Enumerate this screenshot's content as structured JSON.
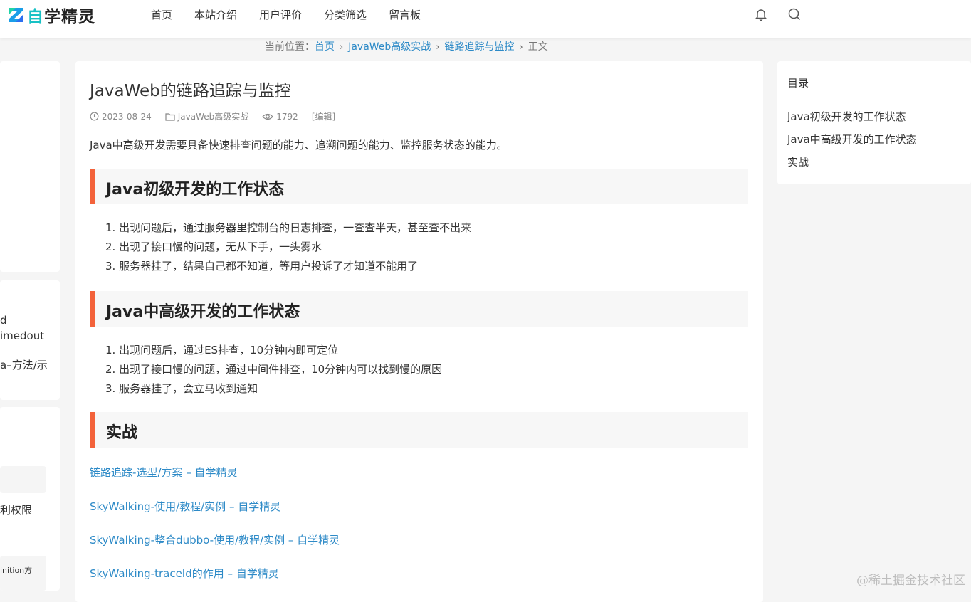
{
  "header": {
    "logo_mark": "Z",
    "logo_zi": "自",
    "logo_rest": "学精灵",
    "nav": [
      "首页",
      "本站介绍",
      "用户评价",
      "分类筛选",
      "留言板"
    ]
  },
  "breadcrumb": {
    "prefix": "当前位置：",
    "items": [
      "首页",
      "JavaWeb高级实战",
      "链路追踪与监控"
    ],
    "current": "正文",
    "sep": "›"
  },
  "left_sidebar": {
    "texts": [
      "d",
      "imedout",
      "a–方法/示",
      "利权限",
      "inition方"
    ]
  },
  "article": {
    "title": "JavaWeb的链路追踪与监控",
    "date": "2023-08-24",
    "category": "JavaWeb高级实战",
    "views": "1792",
    "edit": "[编辑]",
    "intro": "Java中高级开发需要具备快速排查问题的能力、追溯问题的能力、监控服务状态的能力。",
    "sections": [
      {
        "heading": "Java初级开发的工作状态",
        "items": [
          "1. 出现问题后，通过服务器里控制台的日志排查，一查查半天，甚至查不出来",
          "2. 出现了接口慢的问题，无从下手，一头雾水",
          "3. 服务器挂了，结果自己都不知道，等用户投诉了才知道不能用了"
        ]
      },
      {
        "heading": "Java中高级开发的工作状态",
        "items": [
          "1. 出现问题后，通过ES排查，10分钟内即可定位",
          "2. 出现了接口慢的问题，通过中间件排查，10分钟内可以找到慢的原因",
          "3. 服务器挂了，会立马收到通知"
        ]
      },
      {
        "heading": "实战",
        "items": []
      }
    ],
    "links": [
      "链路追踪-选型/方案 – 自学精灵",
      "SkyWalking-使用/教程/实例 – 自学精灵",
      "SkyWalking-整合dubbo-使用/教程/实例 – 自学精灵",
      "SkyWalking-traceId的作用 – 自学精灵"
    ]
  },
  "toc": {
    "title": "目录",
    "items": [
      "Java初级开发的工作状态",
      "Java中高级开发的工作状态",
      "实战"
    ]
  },
  "watermark": "@稀土掘金技术社区",
  "colors": {
    "accent": "#f3623a",
    "link": "#2d8ac7",
    "brand": "#18c1c5",
    "background": "#f5f5f5"
  }
}
